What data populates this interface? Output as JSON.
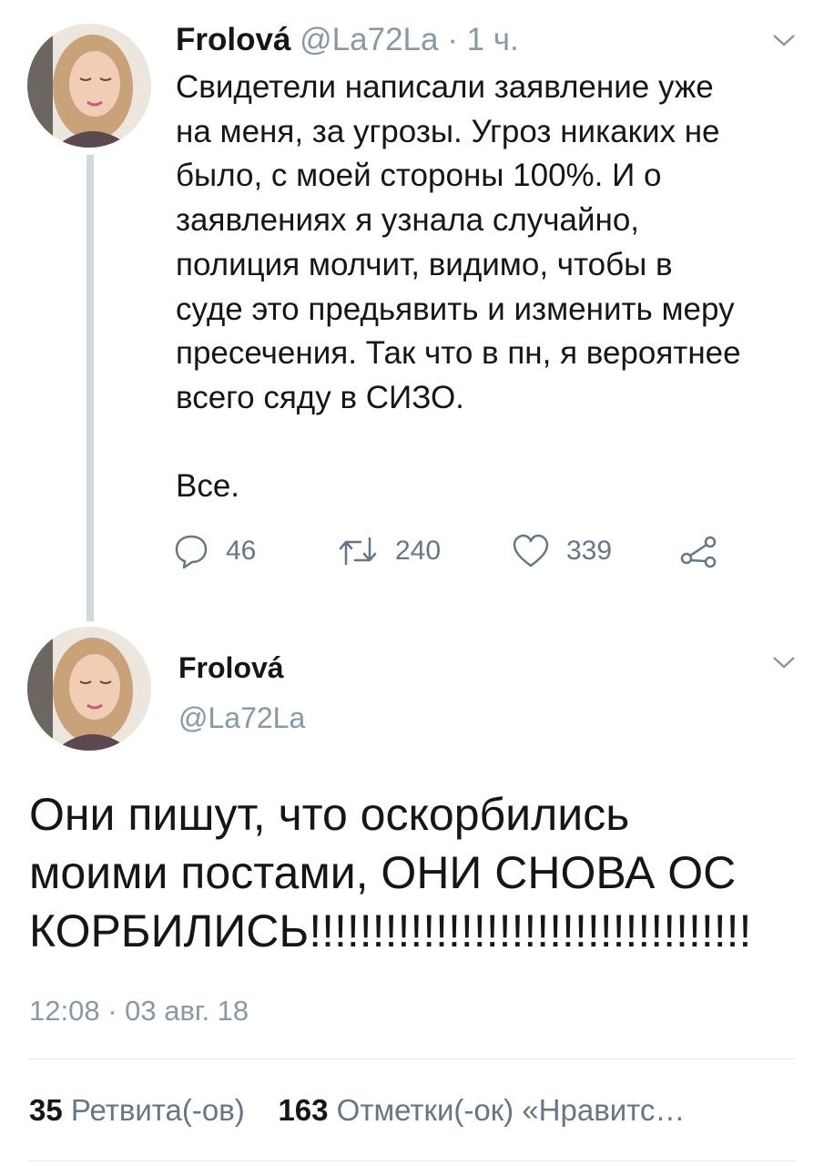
{
  "tweet1": {
    "name": "Frolová",
    "handle": "@La72La",
    "separator": " · ",
    "age": "1 ч.",
    "lines": [
      "Свидетели написали заявление уже",
      "на меня, за угрозы. Угроз никаких не",
      "было, с моей стороны 100%. И о",
      "заявлениях я узнала случайно,",
      "полиция молчит, видимо, чтобы в",
      "суде это предьявить и изменить меру",
      "пресечения. Так что в пн, я вероятнее",
      "всего сяду в СИЗО."
    ],
    "closing": "Все.",
    "replies": "46",
    "retweets": "240",
    "likes": "339"
  },
  "tweet2": {
    "name": "Frolová",
    "handle": "@La72La",
    "lines": [
      "Они пишут, что оскорбились",
      "моими постами, ОНИ СНОВА ОС",
      "КОРБИЛИСЬ!!!!!!!!!!!!!!!!!!!!!!!!!!!!!!!!!!!"
    ],
    "timestamp": "12:08 · 03 авг. 18",
    "retweet_count": "35",
    "retweet_label": "Ретвита(-ов)",
    "like_count": "163",
    "like_label": "Отметки(-ок) «Нравитс…"
  },
  "icons": {
    "reply": "reply-icon",
    "retweet": "retweet-icon",
    "like": "heart-icon",
    "share": "share-icon",
    "menu": "chevron-down-icon"
  },
  "colors": {
    "text": "#14171a",
    "muted": "#8899a6",
    "action": "#657786",
    "thread_line": "#cfd9de"
  }
}
